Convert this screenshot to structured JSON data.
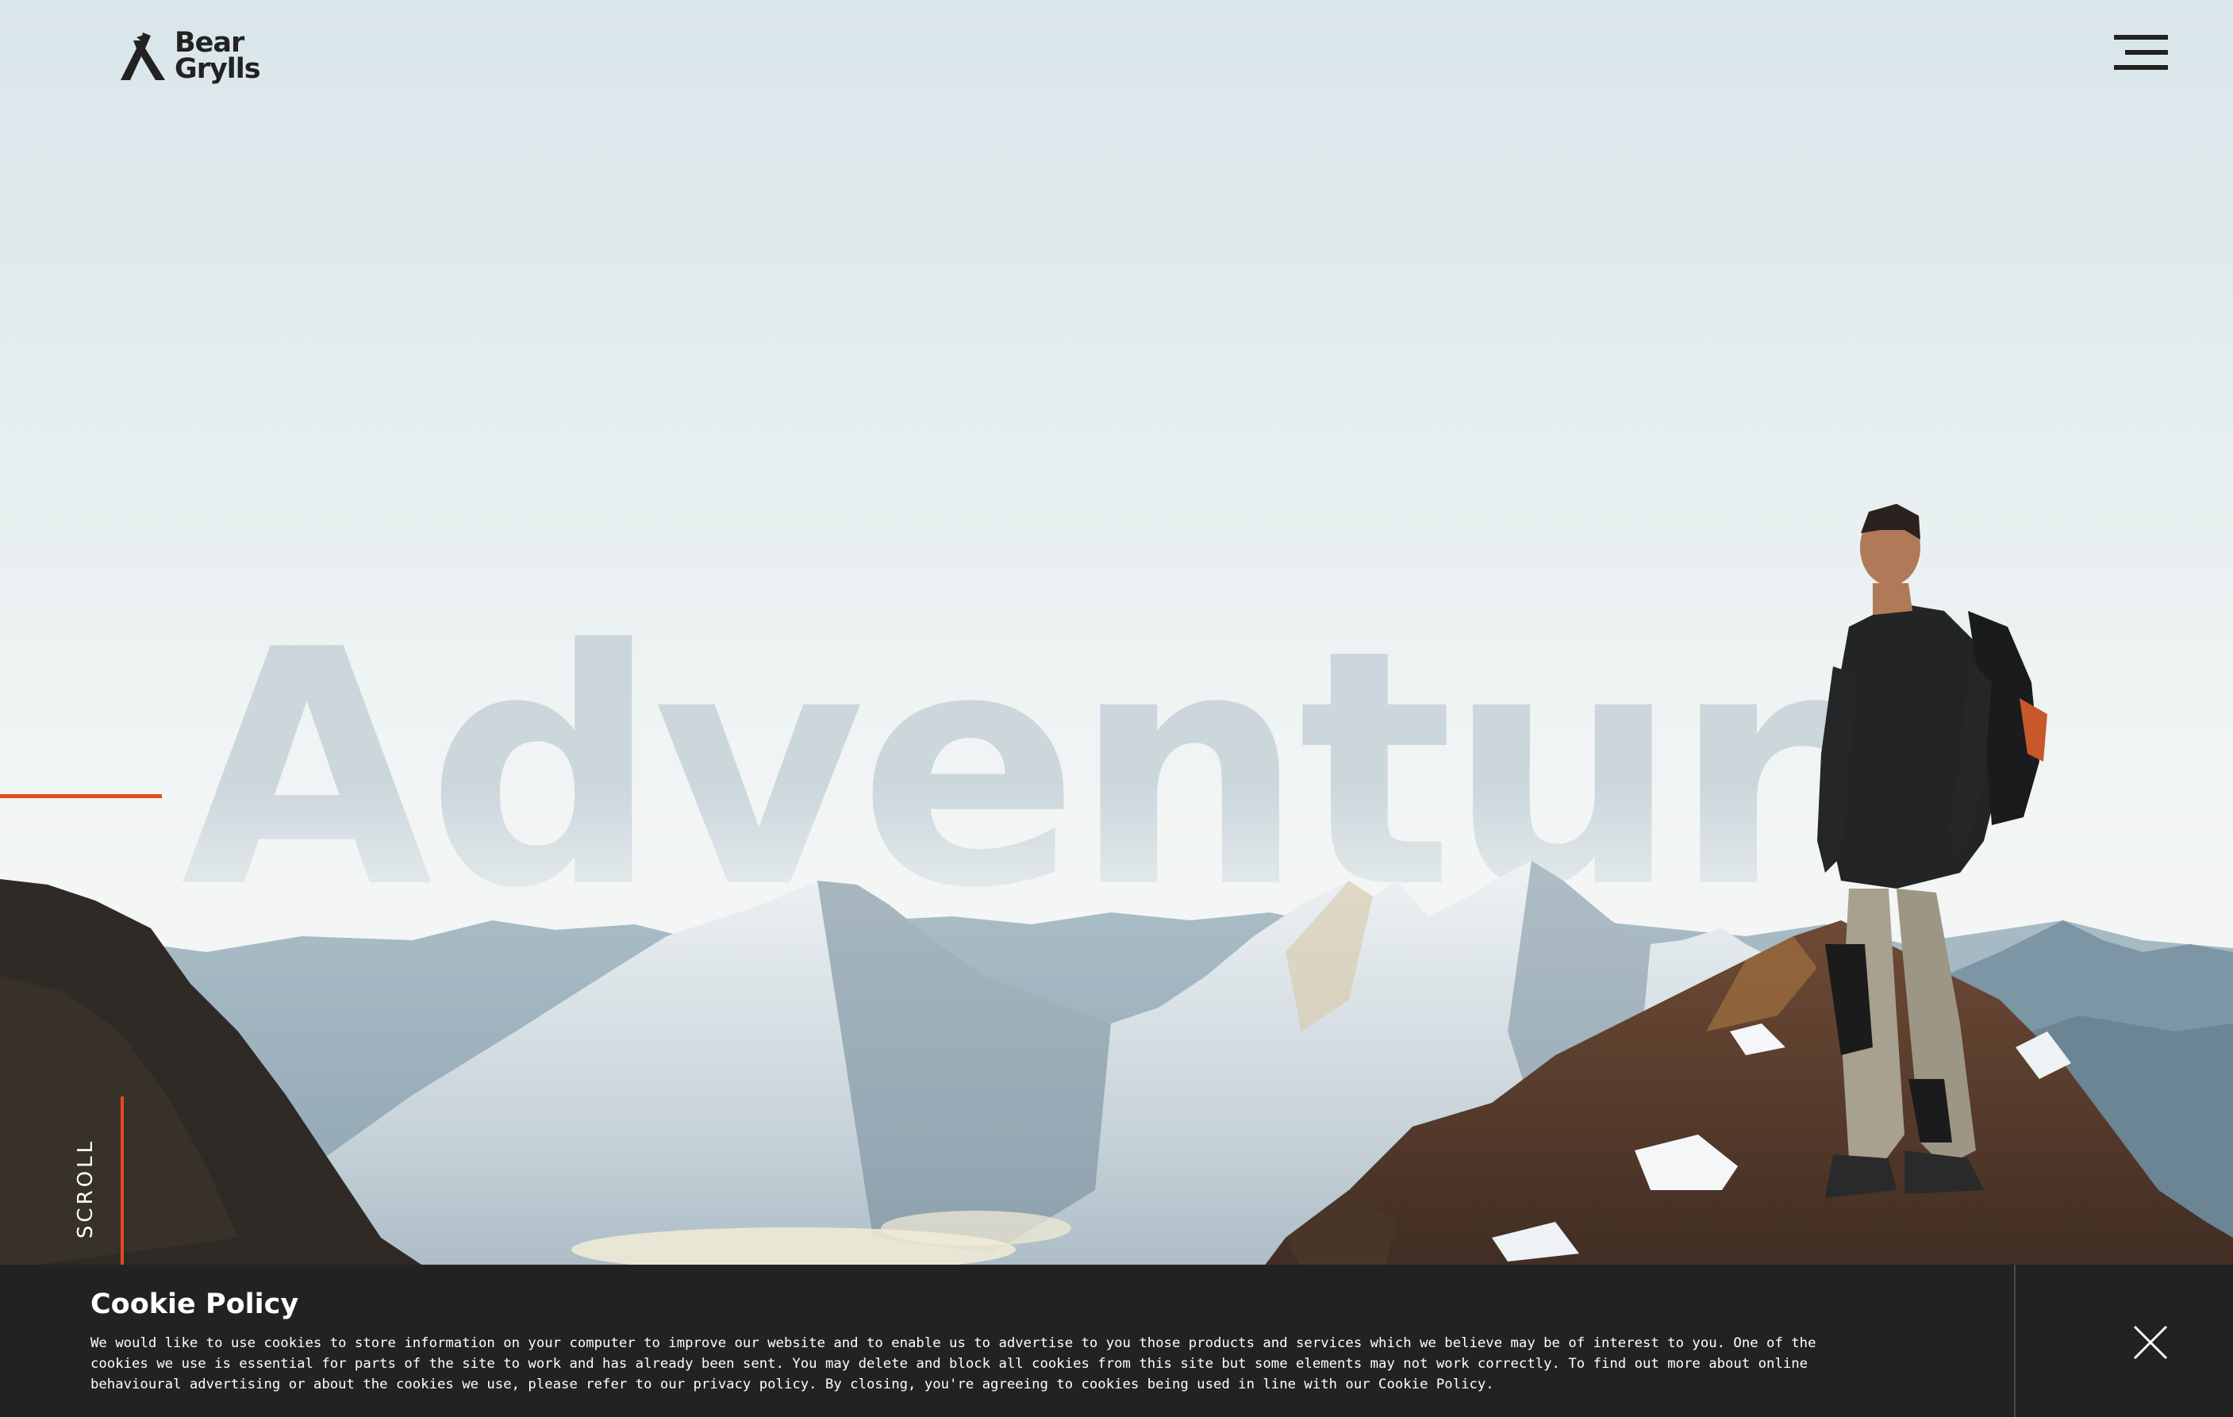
{
  "brand": {
    "name_line1": "Bear",
    "name_line2": "Grylls",
    "icon": "bear-grylls-logo-icon",
    "text_color": "#222222"
  },
  "header": {
    "menu_icon": "hamburger-menu-icon"
  },
  "hero": {
    "headline": "Adventure",
    "accent_color": "#e34a1f",
    "scroll_label": "SCROLL"
  },
  "cookie_banner": {
    "title": "Cookie Policy",
    "body": "We would like to use cookies to store information on your computer to improve our website and to enable us to advertise to you those products and services which we believe may be of interest to you. One of the cookies we use is essential for parts of the site to work and has already been sent. You may delete and block all cookies from this site but some elements may not work correctly. To find out more about online behavioural advertising or about the cookies we use, please refer to our privacy policy. By closing, you're agreeing to cookies being used in line with our Cookie Policy.",
    "close_icon": "close-icon",
    "background": "#222222"
  }
}
